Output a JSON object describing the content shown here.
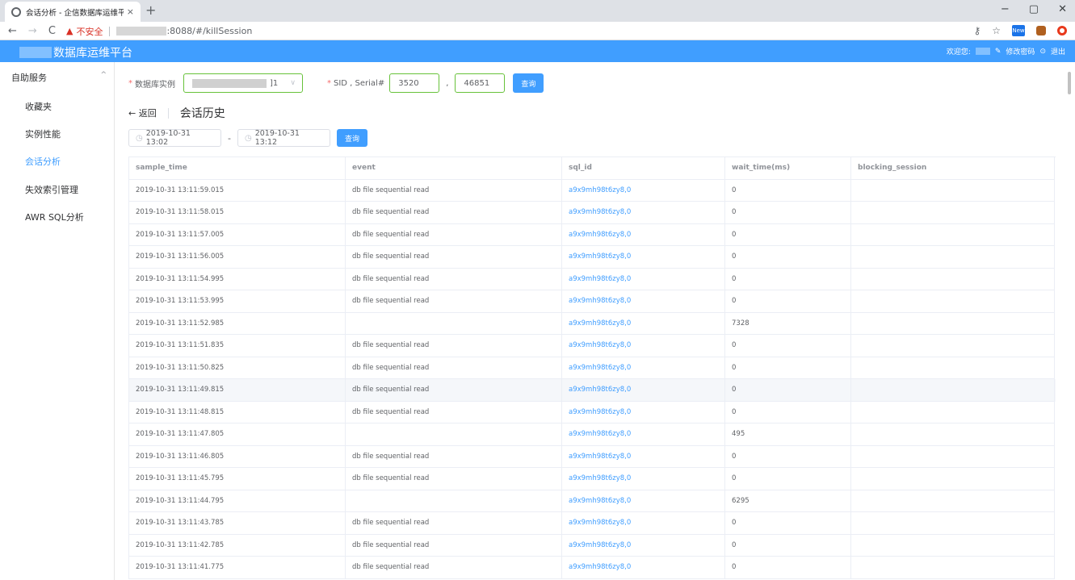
{
  "browser": {
    "tab_title": "会话分析 - 企信数据库运维平台",
    "tab_close": "×",
    "new_tab": "+",
    "win_min": "−",
    "win_max": "▢",
    "win_close": "✕",
    "security_label": "不安全",
    "url": ":8088/#/killSession",
    "ext_new": "New"
  },
  "header": {
    "app_title": "数据库运维平台",
    "welcome": "欢迎您:",
    "change_password": "修改密码",
    "logout": "退出"
  },
  "sidebar": {
    "group": "自助服务",
    "items": [
      {
        "label": "收藏夹",
        "active": false
      },
      {
        "label": "实例性能",
        "active": false
      },
      {
        "label": "会话分析",
        "active": true
      },
      {
        "label": "失效索引管理",
        "active": false
      },
      {
        "label": "AWR SQL分析",
        "active": false
      }
    ]
  },
  "form": {
    "db_label": "数据库实例",
    "db_value_suffix": "]1",
    "sid_label": "SID , Serial#",
    "sid": "3520",
    "serial": "46851",
    "separator": ",",
    "query_btn": "查询"
  },
  "history": {
    "back": "← 返回",
    "title": "会话历史",
    "start": "2019-10-31 13:02",
    "end": "2019-10-31 13:12",
    "range_sep": "-",
    "query_btn": "查询"
  },
  "table": {
    "headers": [
      "sample_time",
      "event",
      "sql_id",
      "wait_time(ms)",
      "blocking_session"
    ],
    "rows": [
      [
        "2019-10-31 13:11:59.015",
        "db file sequential read",
        "a9x9mh98t6zy8,0",
        "0",
        ""
      ],
      [
        "2019-10-31 13:11:58.015",
        "db file sequential read",
        "a9x9mh98t6zy8,0",
        "0",
        ""
      ],
      [
        "2019-10-31 13:11:57.005",
        "db file sequential read",
        "a9x9mh98t6zy8,0",
        "0",
        ""
      ],
      [
        "2019-10-31 13:11:56.005",
        "db file sequential read",
        "a9x9mh98t6zy8,0",
        "0",
        ""
      ],
      [
        "2019-10-31 13:11:54.995",
        "db file sequential read",
        "a9x9mh98t6zy8,0",
        "0",
        ""
      ],
      [
        "2019-10-31 13:11:53.995",
        "db file sequential read",
        "a9x9mh98t6zy8,0",
        "0",
        ""
      ],
      [
        "2019-10-31 13:11:52.985",
        "",
        "a9x9mh98t6zy8,0",
        "7328",
        ""
      ],
      [
        "2019-10-31 13:11:51.835",
        "db file sequential read",
        "a9x9mh98t6zy8,0",
        "0",
        ""
      ],
      [
        "2019-10-31 13:11:50.825",
        "db file sequential read",
        "a9x9mh98t6zy8,0",
        "0",
        ""
      ],
      [
        "2019-10-31 13:11:49.815",
        "db file sequential read",
        "a9x9mh98t6zy8,0",
        "0",
        ""
      ],
      [
        "2019-10-31 13:11:48.815",
        "db file sequential read",
        "a9x9mh98t6zy8,0",
        "0",
        ""
      ],
      [
        "2019-10-31 13:11:47.805",
        "",
        "a9x9mh98t6zy8,0",
        "495",
        ""
      ],
      [
        "2019-10-31 13:11:46.805",
        "db file sequential read",
        "a9x9mh98t6zy8,0",
        "0",
        ""
      ],
      [
        "2019-10-31 13:11:45.795",
        "db file sequential read",
        "a9x9mh98t6zy8,0",
        "0",
        ""
      ],
      [
        "2019-10-31 13:11:44.795",
        "",
        "a9x9mh98t6zy8,0",
        "6295",
        ""
      ],
      [
        "2019-10-31 13:11:43.785",
        "db file sequential read",
        "a9x9mh98t6zy8,0",
        "0",
        ""
      ],
      [
        "2019-10-31 13:11:42.785",
        "db file sequential read",
        "a9x9mh98t6zy8,0",
        "0",
        ""
      ],
      [
        "2019-10-31 13:11:41.775",
        "db file sequential read",
        "a9x9mh98t6zy8,0",
        "0",
        ""
      ]
    ],
    "highlighted_row": 9
  },
  "colors": {
    "primary": "#409eff",
    "valid_border": "#67c23a",
    "required": "#f56c6c",
    "insecure": "#d93025"
  }
}
